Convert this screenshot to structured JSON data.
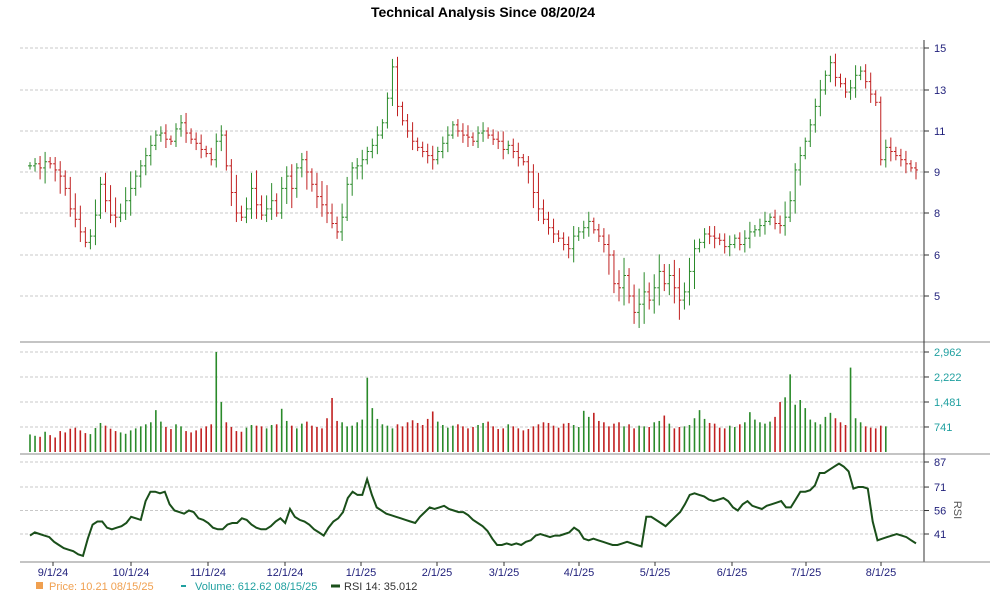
{
  "chart_data": {
    "title": "Technical Analysis Since 08/20/24",
    "x_labels": [
      "9/1/24",
      "10/1/24",
      "11/1/24",
      "12/1/24",
      "1/1/25",
      "2/1/25",
      "3/1/25",
      "4/1/25",
      "5/1/25",
      "6/1/25",
      "7/1/25",
      "8/1/25"
    ],
    "price_panel": {
      "type": "ohlc",
      "y_ticks": [
        "5",
        "6",
        "8",
        "9",
        "11",
        "13",
        "15"
      ],
      "y_tick_values": [
        5,
        6,
        8,
        9,
        11,
        13,
        15
      ],
      "close": [
        9.3,
        9.4,
        9.2,
        9.5,
        9.4,
        9.1,
        8.9,
        8.6,
        8.1,
        7.7,
        7.1,
        6.6,
        6.9,
        7.9,
        8.7,
        8.3,
        7.9,
        7.8,
        8.0,
        8.3,
        8.6,
        8.9,
        9.3,
        9.8,
        10.3,
        10.8,
        10.9,
        10.6,
        10.5,
        11.1,
        11.4,
        10.9,
        10.6,
        10.4,
        10.1,
        9.9,
        9.6,
        10.5,
        10.8,
        9.3,
        8.5,
        8.0,
        7.8,
        8.1,
        8.6,
        8.2,
        7.9,
        8.1,
        8.3,
        8.0,
        8.6,
        8.9,
        8.6,
        9.2,
        9.6,
        9.0,
        8.7,
        8.4,
        8.2,
        8.0,
        7.5,
        7.1,
        7.8,
        8.7,
        9.2,
        9.3,
        9.6,
        10.0,
        10.3,
        10.8,
        11.4,
        12.6,
        14.1,
        12.2,
        11.5,
        11.0,
        10.5,
        10.2,
        10.0,
        9.8,
        9.6,
        10.0,
        10.4,
        10.8,
        11.3,
        11.0,
        10.8,
        10.7,
        10.5,
        10.9,
        11.0,
        10.8,
        10.6,
        10.5,
        10.1,
        10.3,
        10.0,
        9.7,
        9.5,
        9.0,
        8.5,
        8.1,
        7.7,
        7.3,
        7.0,
        6.8,
        6.5,
        6.3,
        6.9,
        7.1,
        7.3,
        7.6,
        7.2,
        6.9,
        6.5,
        6.0,
        5.3,
        5.2,
        5.5,
        5.0,
        4.6,
        4.8,
        5.1,
        4.9,
        5.2,
        5.6,
        5.3,
        5.5,
        5.2,
        4.9,
        5.1,
        5.6,
        6.3,
        6.6,
        7.0,
        6.9,
        6.8,
        6.7,
        6.4,
        6.5,
        6.8,
        6.5,
        6.8,
        7.1,
        7.2,
        7.4,
        7.6,
        7.8,
        7.5,
        7.4,
        7.8,
        8.3,
        9.1,
        9.8,
        10.5,
        11.3,
        12.2,
        13.0,
        13.7,
        14.3,
        13.6,
        13.3,
        12.9,
        13.1,
        13.7,
        13.9,
        13.4,
        12.8,
        12.4,
        9.6,
        10.2,
        10.0,
        9.8,
        9.6,
        9.4,
        9.2,
        9.1
      ]
    },
    "volume_panel": {
      "type": "bar",
      "y_ticks": [
        "741",
        "1,481",
        "2,222",
        "2,962"
      ],
      "y_tick_values": [
        741,
        1481,
        2222,
        2962
      ],
      "values": [
        520,
        480,
        450,
        600,
        500,
        430,
        620,
        580,
        690,
        720,
        640,
        560,
        530,
        710,
        860,
        780,
        690,
        620,
        580,
        540,
        640,
        700,
        760,
        820,
        880,
        1240,
        900,
        740,
        680,
        820,
        760,
        620,
        580,
        640,
        700,
        760,
        820,
        2962,
        1480,
        880,
        740,
        620,
        600,
        720,
        800,
        780,
        760,
        700,
        800,
        820,
        1280,
        920,
        780,
        700,
        840,
        900,
        780,
        740,
        700,
        1000,
        1600,
        920,
        880,
        760,
        780,
        880,
        960,
        2200,
        1300,
        980,
        820,
        780,
        700,
        820,
        760,
        880,
        940,
        860,
        800,
        980,
        1200,
        900,
        800,
        720,
        780,
        820,
        760,
        700,
        740,
        800,
        860,
        900,
        760,
        680,
        700,
        820,
        760,
        700,
        640,
        680,
        760,
        820,
        880,
        860,
        780,
        720,
        840,
        860,
        800,
        740,
        1220,
        1040,
        1160,
        920,
        880,
        760,
        840,
        880,
        760,
        820,
        700,
        780,
        760,
        740,
        880,
        920,
        1080,
        840,
        700,
        740,
        760,
        800,
        1000,
        1240,
        980,
        860,
        840,
        720,
        700,
        780,
        740,
        820,
        880,
        1180,
        960,
        880,
        840,
        900,
        1040,
        1480,
        1620,
        2300,
        1400,
        1540,
        1300,
        960,
        880,
        820,
        1040,
        1160,
        1000,
        880,
        800,
        2500,
        1000,
        880,
        760,
        720,
        700,
        780,
        760
      ]
    },
    "rsi_panel": {
      "type": "line",
      "y_ticks": [
        "41",
        "56",
        "71",
        "87"
      ],
      "y_tick_values": [
        41,
        56,
        71,
        87
      ],
      "values": [
        40,
        42,
        41,
        40,
        39,
        36,
        34,
        32,
        31,
        30,
        28,
        27,
        38,
        47,
        49,
        49,
        45,
        44,
        45,
        46,
        48,
        52,
        51,
        50,
        62,
        68,
        68,
        67,
        68,
        60,
        56,
        55,
        54,
        56,
        55,
        51,
        50,
        48,
        45,
        44,
        44,
        47,
        48,
        48,
        51,
        50,
        47,
        45,
        44,
        44,
        46,
        49,
        51,
        48,
        57,
        52,
        50,
        49,
        47,
        44,
        42,
        40,
        45,
        49,
        51,
        55,
        64,
        68,
        66,
        66,
        76,
        66,
        58,
        56,
        54,
        53,
        52,
        51,
        50,
        49,
        48,
        52,
        55,
        58,
        57,
        58,
        59,
        57,
        56,
        55,
        55,
        53,
        50,
        48,
        46,
        43,
        38,
        34,
        34,
        35,
        34,
        35,
        34,
        36,
        37,
        40,
        41,
        40,
        39,
        40,
        40,
        41,
        42,
        45,
        43,
        38,
        37,
        38,
        37,
        36,
        35,
        34,
        34,
        35,
        36,
        35,
        34,
        33,
        52,
        52,
        50,
        48,
        46,
        49,
        52,
        55,
        60,
        66,
        67,
        66,
        65,
        63,
        62,
        63,
        64,
        62,
        58,
        56,
        60,
        62,
        59,
        58,
        57,
        59,
        60,
        61,
        62,
        58,
        58,
        63,
        68,
        68,
        69,
        72,
        80,
        80,
        82,
        84,
        86,
        84,
        81,
        70,
        71,
        71,
        70,
        49,
        37,
        38,
        39,
        40,
        41,
        40,
        39,
        37,
        35
      ]
    },
    "legend": [
      {
        "label": "Price: 10.21  08/15/25",
        "color": "#f0a050",
        "marker": "square"
      },
      {
        "label": "Volume: 612.62  08/15/25",
        "color": "#20a0a0",
        "marker": "dash"
      },
      {
        "label": "RSI 14: 35.012",
        "color": "#1a4f1a",
        "marker": "line"
      }
    ],
    "colors": {
      "up": "#2a8a2a",
      "down": "#c02020",
      "rsi": "#1a4f1a",
      "grid": "#c8c8c8",
      "axis_text": "#1f1f7a"
    }
  }
}
